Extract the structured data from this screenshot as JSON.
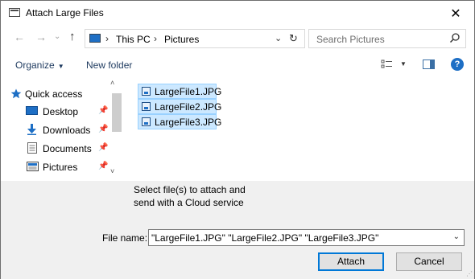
{
  "window": {
    "title": "Attach Large Files",
    "close_glyph": "✕",
    "title_icon": "window-icon"
  },
  "nav": {
    "back_glyph": "←",
    "forward_glyph": "→",
    "recent_glyph": "⌄",
    "up_glyph": "↑",
    "breadcrumb": [
      "This PC",
      "Pictures"
    ],
    "breadcrumb_sep": "›",
    "dropdown_glyph": "⌄",
    "refresh_glyph": "↻",
    "search_placeholder": "Search Pictures"
  },
  "toolbar": {
    "organize_label": "Organize",
    "organize_arrow": "▼",
    "new_folder_label": "New folder",
    "view_drop": "▼",
    "help_label": "?"
  },
  "sidebar": {
    "items": [
      {
        "label": "Quick access",
        "icon": "star-icon"
      },
      {
        "label": "Desktop",
        "icon": "desktop-icon",
        "pinned": true
      },
      {
        "label": "Downloads",
        "icon": "download-icon",
        "pinned": true
      },
      {
        "label": "Documents",
        "icon": "document-icon",
        "pinned": true
      },
      {
        "label": "Pictures",
        "icon": "pictures-icon",
        "pinned": true
      }
    ],
    "pin_glyph": "📌",
    "scroll_up": "˄",
    "scroll_down": "˅"
  },
  "files": [
    {
      "name": "LargeFile1.JPG",
      "selected": true
    },
    {
      "name": "LargeFile2.JPG",
      "selected": true
    },
    {
      "name": "LargeFile3.JPG",
      "selected": true
    }
  ],
  "footer": {
    "cloud_note": "Select file(s) to attach and send with a Cloud service",
    "file_name_label": "File name:",
    "file_name_value": "\"LargeFile1.JPG\" \"LargeFile2.JPG\" \"LargeFile3.JPG\"",
    "file_name_dropdown": "⌄",
    "attach_label": "Attach",
    "cancel_label": "Cancel"
  },
  "colors": {
    "selection_bg": "#cce8ff",
    "selection_border": "#99d1ff",
    "accent": "#0078d7",
    "help": "#1e6fc5"
  }
}
